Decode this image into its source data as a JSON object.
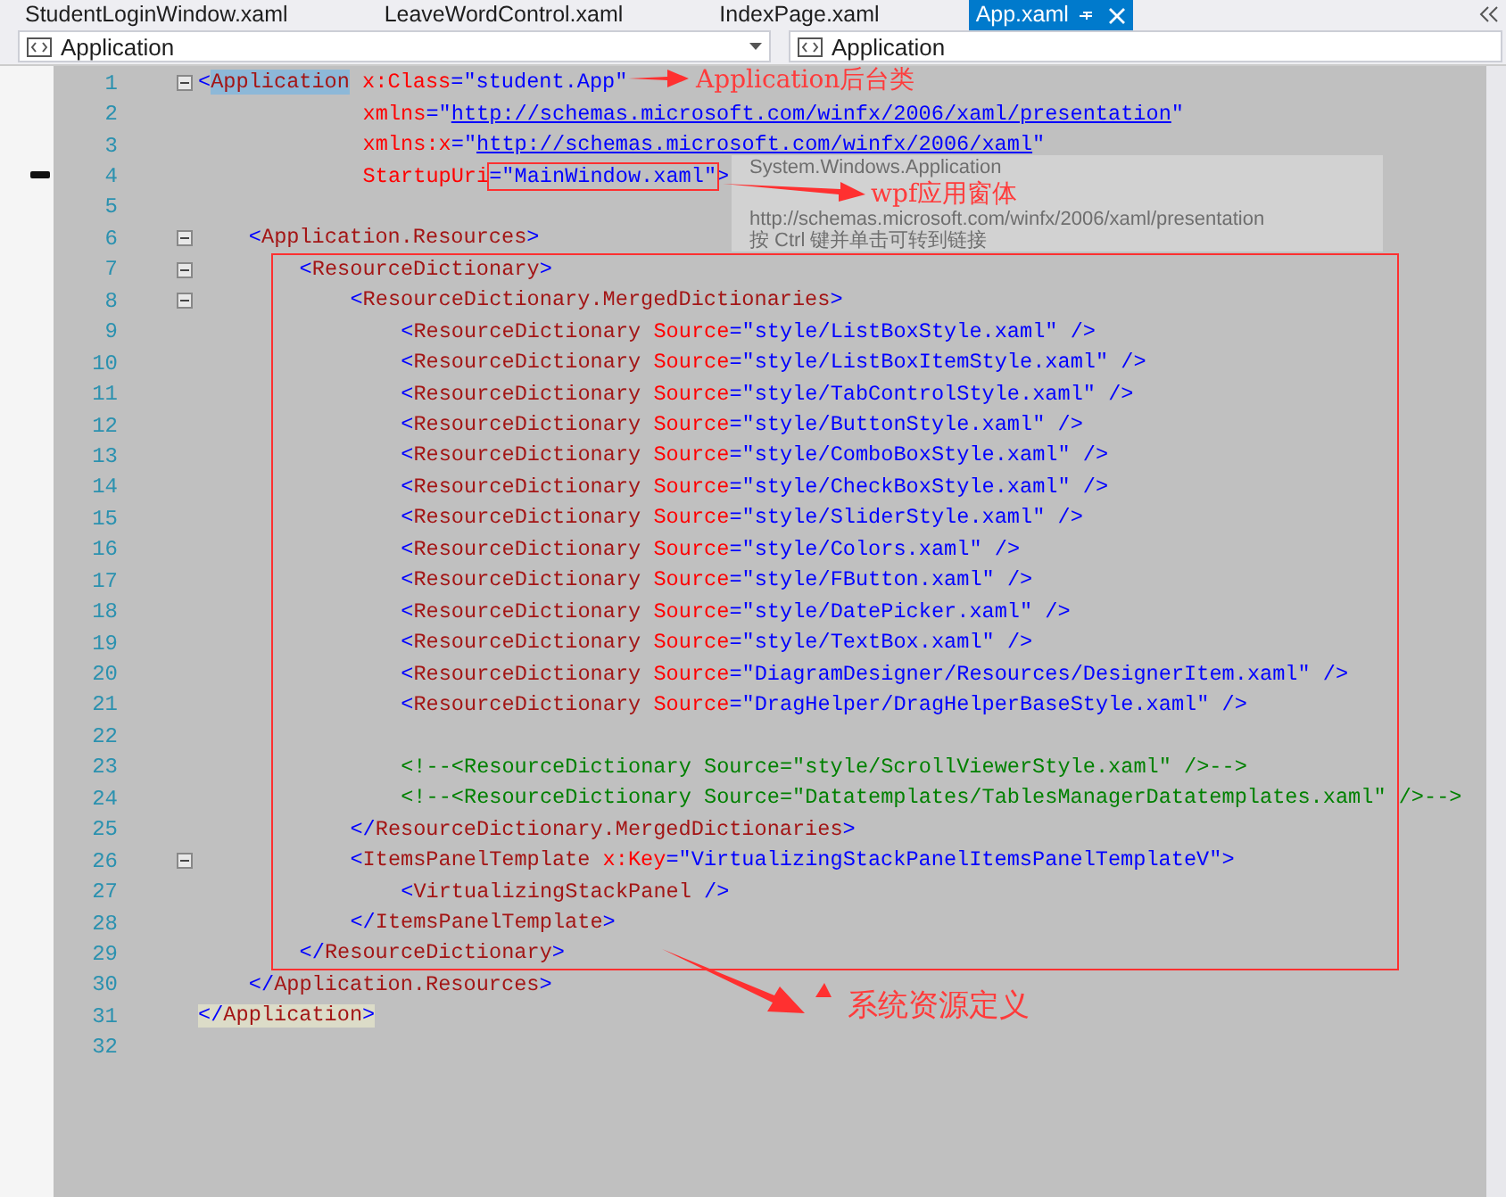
{
  "tabs": [
    {
      "label": "StudentLoginWindow.xaml",
      "selected": false
    },
    {
      "label": "LeaveWordControl.xaml",
      "selected": false
    },
    {
      "label": "IndexPage.xaml",
      "selected": false
    },
    {
      "label": "App.xaml",
      "selected": true
    }
  ],
  "navigation": {
    "type_scope": "Application",
    "member_scope": "Application"
  },
  "lines": [
    {
      "number": "1",
      "fold": true,
      "tokens": [
        {
          "kind": "bracket",
          "text": "<"
        },
        {
          "kind": "element",
          "text": "Application",
          "selected": true
        },
        {
          "kind": "attribute",
          "text": " x:Class"
        },
        {
          "kind": "value",
          "text": "=\"student.App\""
        }
      ]
    },
    {
      "number": "2",
      "fold": false,
      "tokens": [
        {
          "kind": "attribute",
          "text": "xmlns"
        },
        {
          "kind": "value",
          "text": "=\""
        },
        {
          "kind": "link",
          "text": "http://schemas.microsoft.com/winfx/2006/xaml/presentation"
        },
        {
          "kind": "value",
          "text": "\""
        }
      ]
    },
    {
      "number": "3",
      "fold": false,
      "tokens": [
        {
          "kind": "attribute",
          "text": "xmlns:x"
        },
        {
          "kind": "value",
          "text": "=\""
        },
        {
          "kind": "link",
          "text": "http://schemas.microsoft.com/winfx/2006/xaml"
        },
        {
          "kind": "value",
          "text": "\""
        }
      ]
    },
    {
      "number": "4",
      "fold": false,
      "tokens": [
        {
          "kind": "attribute",
          "text": "StartupUri"
        },
        {
          "kind": "value",
          "text": "=\"MainWindow.xaml\""
        },
        {
          "kind": "bracket",
          "text": ">"
        }
      ]
    },
    {
      "number": "5",
      "fold": false
    },
    {
      "number": "6",
      "fold": true,
      "tokens": [
        {
          "kind": "bracket",
          "text": "<"
        },
        {
          "kind": "element",
          "text": "Application.Resources"
        },
        {
          "kind": "bracket",
          "text": ">"
        }
      ]
    },
    {
      "number": "7",
      "fold": true,
      "tokens": [
        {
          "kind": "bracket",
          "text": "<"
        },
        {
          "kind": "element",
          "text": "ResourceDictionary"
        },
        {
          "kind": "bracket",
          "text": ">"
        }
      ]
    },
    {
      "number": "8",
      "fold": true,
      "tokens": [
        {
          "kind": "bracket",
          "text": "<"
        },
        {
          "kind": "element",
          "text": "ResourceDictionary.MergedDictionaries"
        },
        {
          "kind": "bracket",
          "text": ">"
        }
      ]
    },
    {
      "number": "9",
      "fold": false,
      "tokens": [
        {
          "kind": "bracket",
          "text": "<"
        },
        {
          "kind": "element",
          "text": "ResourceDictionary"
        },
        {
          "kind": "attribute",
          "text": " Source"
        },
        {
          "kind": "value",
          "text": "=\"style/ListBoxStyle.xaml\""
        },
        {
          "kind": "bracket",
          "text": " />"
        }
      ]
    },
    {
      "number": "10",
      "fold": false,
      "tokens": [
        {
          "kind": "bracket",
          "text": "<"
        },
        {
          "kind": "element",
          "text": "ResourceDictionary"
        },
        {
          "kind": "attribute",
          "text": " Source"
        },
        {
          "kind": "value",
          "text": "=\"style/ListBoxItemStyle.xaml\""
        },
        {
          "kind": "bracket",
          "text": " />"
        }
      ]
    },
    {
      "number": "11",
      "fold": false,
      "tokens": [
        {
          "kind": "bracket",
          "text": "<"
        },
        {
          "kind": "element",
          "text": "ResourceDictionary"
        },
        {
          "kind": "attribute",
          "text": " Source"
        },
        {
          "kind": "value",
          "text": "=\"style/TabControlStyle.xaml\""
        },
        {
          "kind": "bracket",
          "text": " />"
        }
      ]
    },
    {
      "number": "12",
      "fold": false,
      "tokens": [
        {
          "kind": "bracket",
          "text": "<"
        },
        {
          "kind": "element",
          "text": "ResourceDictionary"
        },
        {
          "kind": "attribute",
          "text": " Source"
        },
        {
          "kind": "value",
          "text": "=\"style/ButtonStyle.xaml\""
        },
        {
          "kind": "bracket",
          "text": " />"
        }
      ]
    },
    {
      "number": "13",
      "fold": false,
      "tokens": [
        {
          "kind": "bracket",
          "text": "<"
        },
        {
          "kind": "element",
          "text": "ResourceDictionary"
        },
        {
          "kind": "attribute",
          "text": " Source"
        },
        {
          "kind": "value",
          "text": "=\"style/ComboBoxStyle.xaml\""
        },
        {
          "kind": "bracket",
          "text": " />"
        }
      ]
    },
    {
      "number": "14",
      "fold": false,
      "tokens": [
        {
          "kind": "bracket",
          "text": "<"
        },
        {
          "kind": "element",
          "text": "ResourceDictionary"
        },
        {
          "kind": "attribute",
          "text": " Source"
        },
        {
          "kind": "value",
          "text": "=\"style/CheckBoxStyle.xaml\""
        },
        {
          "kind": "bracket",
          "text": " />"
        }
      ]
    },
    {
      "number": "15",
      "fold": false,
      "tokens": [
        {
          "kind": "bracket",
          "text": "<"
        },
        {
          "kind": "element",
          "text": "ResourceDictionary"
        },
        {
          "kind": "attribute",
          "text": " Source"
        },
        {
          "kind": "value",
          "text": "=\"style/SliderStyle.xaml\""
        },
        {
          "kind": "bracket",
          "text": " />"
        }
      ]
    },
    {
      "number": "16",
      "fold": false,
      "tokens": [
        {
          "kind": "bracket",
          "text": "<"
        },
        {
          "kind": "element",
          "text": "ResourceDictionary"
        },
        {
          "kind": "attribute",
          "text": " Source"
        },
        {
          "kind": "value",
          "text": "=\"style/Colors.xaml\""
        },
        {
          "kind": "bracket",
          "text": " />"
        }
      ]
    },
    {
      "number": "17",
      "fold": false,
      "tokens": [
        {
          "kind": "bracket",
          "text": "<"
        },
        {
          "kind": "element",
          "text": "ResourceDictionary"
        },
        {
          "kind": "attribute",
          "text": " Source"
        },
        {
          "kind": "value",
          "text": "=\"style/FButton.xaml\""
        },
        {
          "kind": "bracket",
          "text": " />"
        }
      ]
    },
    {
      "number": "18",
      "fold": false,
      "tokens": [
        {
          "kind": "bracket",
          "text": "<"
        },
        {
          "kind": "element",
          "text": "ResourceDictionary"
        },
        {
          "kind": "attribute",
          "text": " Source"
        },
        {
          "kind": "value",
          "text": "=\"style/DatePicker.xaml\""
        },
        {
          "kind": "bracket",
          "text": " />"
        }
      ]
    },
    {
      "number": "19",
      "fold": false,
      "tokens": [
        {
          "kind": "bracket",
          "text": "<"
        },
        {
          "kind": "element",
          "text": "ResourceDictionary"
        },
        {
          "kind": "attribute",
          "text": " Source"
        },
        {
          "kind": "value",
          "text": "=\"style/TextBox.xaml\""
        },
        {
          "kind": "bracket",
          "text": " />"
        }
      ]
    },
    {
      "number": "20",
      "fold": false,
      "tokens": [
        {
          "kind": "bracket",
          "text": "<"
        },
        {
          "kind": "element",
          "text": "ResourceDictionary"
        },
        {
          "kind": "attribute",
          "text": " Source"
        },
        {
          "kind": "value",
          "text": "=\"DiagramDesigner/Resources/DesignerItem.xaml\""
        },
        {
          "kind": "bracket",
          "text": " />"
        }
      ]
    },
    {
      "number": "21",
      "fold": false,
      "tokens": [
        {
          "kind": "bracket",
          "text": "<"
        },
        {
          "kind": "element",
          "text": "ResourceDictionary"
        },
        {
          "kind": "attribute",
          "text": " Source"
        },
        {
          "kind": "value",
          "text": "=\"DragHelper/DragHelperBaseStyle.xaml\""
        },
        {
          "kind": "bracket",
          "text": " />"
        }
      ]
    },
    {
      "number": "22",
      "fold": false
    },
    {
      "number": "23",
      "fold": false,
      "tokens": [
        {
          "kind": "comment",
          "text": "<!--<ResourceDictionary Source=\"style/ScrollViewerStyle.xaml\" />-->"
        }
      ]
    },
    {
      "number": "24",
      "fold": false,
      "tokens": [
        {
          "kind": "comment",
          "text": "<!--<ResourceDictionary Source=\"Datatemplates/TablesManagerDatatemplates.xaml\" />-->"
        }
      ]
    },
    {
      "number": "25",
      "fold": false,
      "tokens": [
        {
          "kind": "bracket",
          "text": "</"
        },
        {
          "kind": "element",
          "text": "ResourceDictionary.MergedDictionaries"
        },
        {
          "kind": "bracket",
          "text": ">"
        }
      ]
    },
    {
      "number": "26",
      "fold": true,
      "tokens": [
        {
          "kind": "bracket",
          "text": "<"
        },
        {
          "kind": "element",
          "text": "ItemsPanelTemplate"
        },
        {
          "kind": "attribute",
          "text": " x:Key"
        },
        {
          "kind": "value",
          "text": "=\"VirtualizingStackPanelItemsPanelTemplateV\""
        },
        {
          "kind": "bracket",
          "text": ">"
        }
      ]
    },
    {
      "number": "27",
      "fold": false,
      "tokens": [
        {
          "kind": "bracket",
          "text": "<"
        },
        {
          "kind": "element",
          "text": "VirtualizingStackPanel"
        },
        {
          "kind": "bracket",
          "text": " />"
        }
      ]
    },
    {
      "number": "28",
      "fold": false,
      "tokens": [
        {
          "kind": "bracket",
          "text": "</"
        },
        {
          "kind": "element",
          "text": "ItemsPanelTemplate"
        },
        {
          "kind": "bracket",
          "text": ">"
        }
      ]
    },
    {
      "number": "29",
      "fold": false,
      "tokens": [
        {
          "kind": "bracket",
          "text": "</"
        },
        {
          "kind": "element",
          "text": "ResourceDictionary"
        },
        {
          "kind": "bracket",
          "text": ">"
        }
      ]
    },
    {
      "number": "30",
      "fold": false,
      "tokens": [
        {
          "kind": "bracket",
          "text": "</"
        },
        {
          "kind": "element",
          "text": "Application.Resources"
        },
        {
          "kind": "bracket",
          "text": ">"
        }
      ]
    },
    {
      "number": "31",
      "fold": false,
      "matched": true,
      "tokens": [
        {
          "kind": "bracket",
          "text": "</"
        },
        {
          "kind": "element",
          "text": "Application"
        },
        {
          "kind": "bracket",
          "text": ">"
        }
      ]
    },
    {
      "number": "32",
      "fold": false
    }
  ],
  "tooltip": {
    "title": "System.Windows.Application",
    "url": "http://schemas.microsoft.com/winfx/2006/xaml/presentation",
    "hint": "按 Ctrl 键并单击可转到链接"
  },
  "annotations": [
    {
      "text": "Application后台类"
    },
    {
      "text": "wpf应用窗体"
    },
    {
      "text": "系统资源定义"
    }
  ]
}
